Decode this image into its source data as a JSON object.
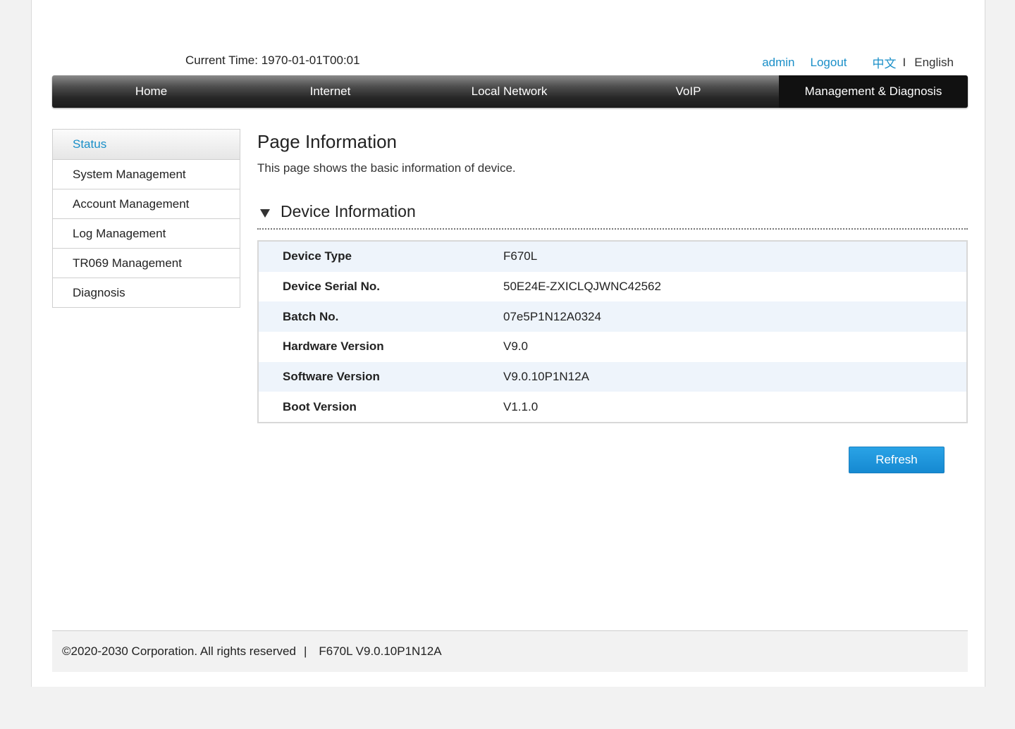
{
  "header": {
    "current_time": "Current Time: 1970-01-01T00:01",
    "user": "admin",
    "logout": "Logout",
    "lang_zh": "中文",
    "lang_sep": "I",
    "lang_en": "English"
  },
  "nav": {
    "items": [
      {
        "label": "Home"
      },
      {
        "label": "Internet"
      },
      {
        "label": "Local Network"
      },
      {
        "label": "VoIP"
      },
      {
        "label": "Management & Diagnosis",
        "active": true
      }
    ]
  },
  "sidebar": {
    "items": [
      {
        "label": "Status",
        "active": true
      },
      {
        "label": "System Management"
      },
      {
        "label": "Account Management"
      },
      {
        "label": "Log Management"
      },
      {
        "label": "TR069 Management"
      },
      {
        "label": "Diagnosis"
      }
    ]
  },
  "main": {
    "title": "Page Information",
    "description": "This page shows the basic information of device.",
    "section_title": "Device Information",
    "rows": [
      {
        "label": "Device Type",
        "value": "F670L"
      },
      {
        "label": "Device Serial No.",
        "value": "50E24E-ZXICLQJWNC42562"
      },
      {
        "label": "Batch No.",
        "value": "07e5P1N12A0324"
      },
      {
        "label": "Hardware Version",
        "value": "V9.0"
      },
      {
        "label": "Software Version",
        "value": "V9.0.10P1N12A"
      },
      {
        "label": "Boot Version",
        "value": "V1.1.0"
      }
    ],
    "refresh_label": "Refresh"
  },
  "footer": {
    "copyright": "©2020-2030 Corporation. All rights reserved",
    "separator": "|",
    "version": "F670L V9.0.10P1N12A"
  },
  "colors": {
    "accent": "#1a8fc8",
    "button": "#1589d1",
    "row_alt": "#eef4fb"
  }
}
